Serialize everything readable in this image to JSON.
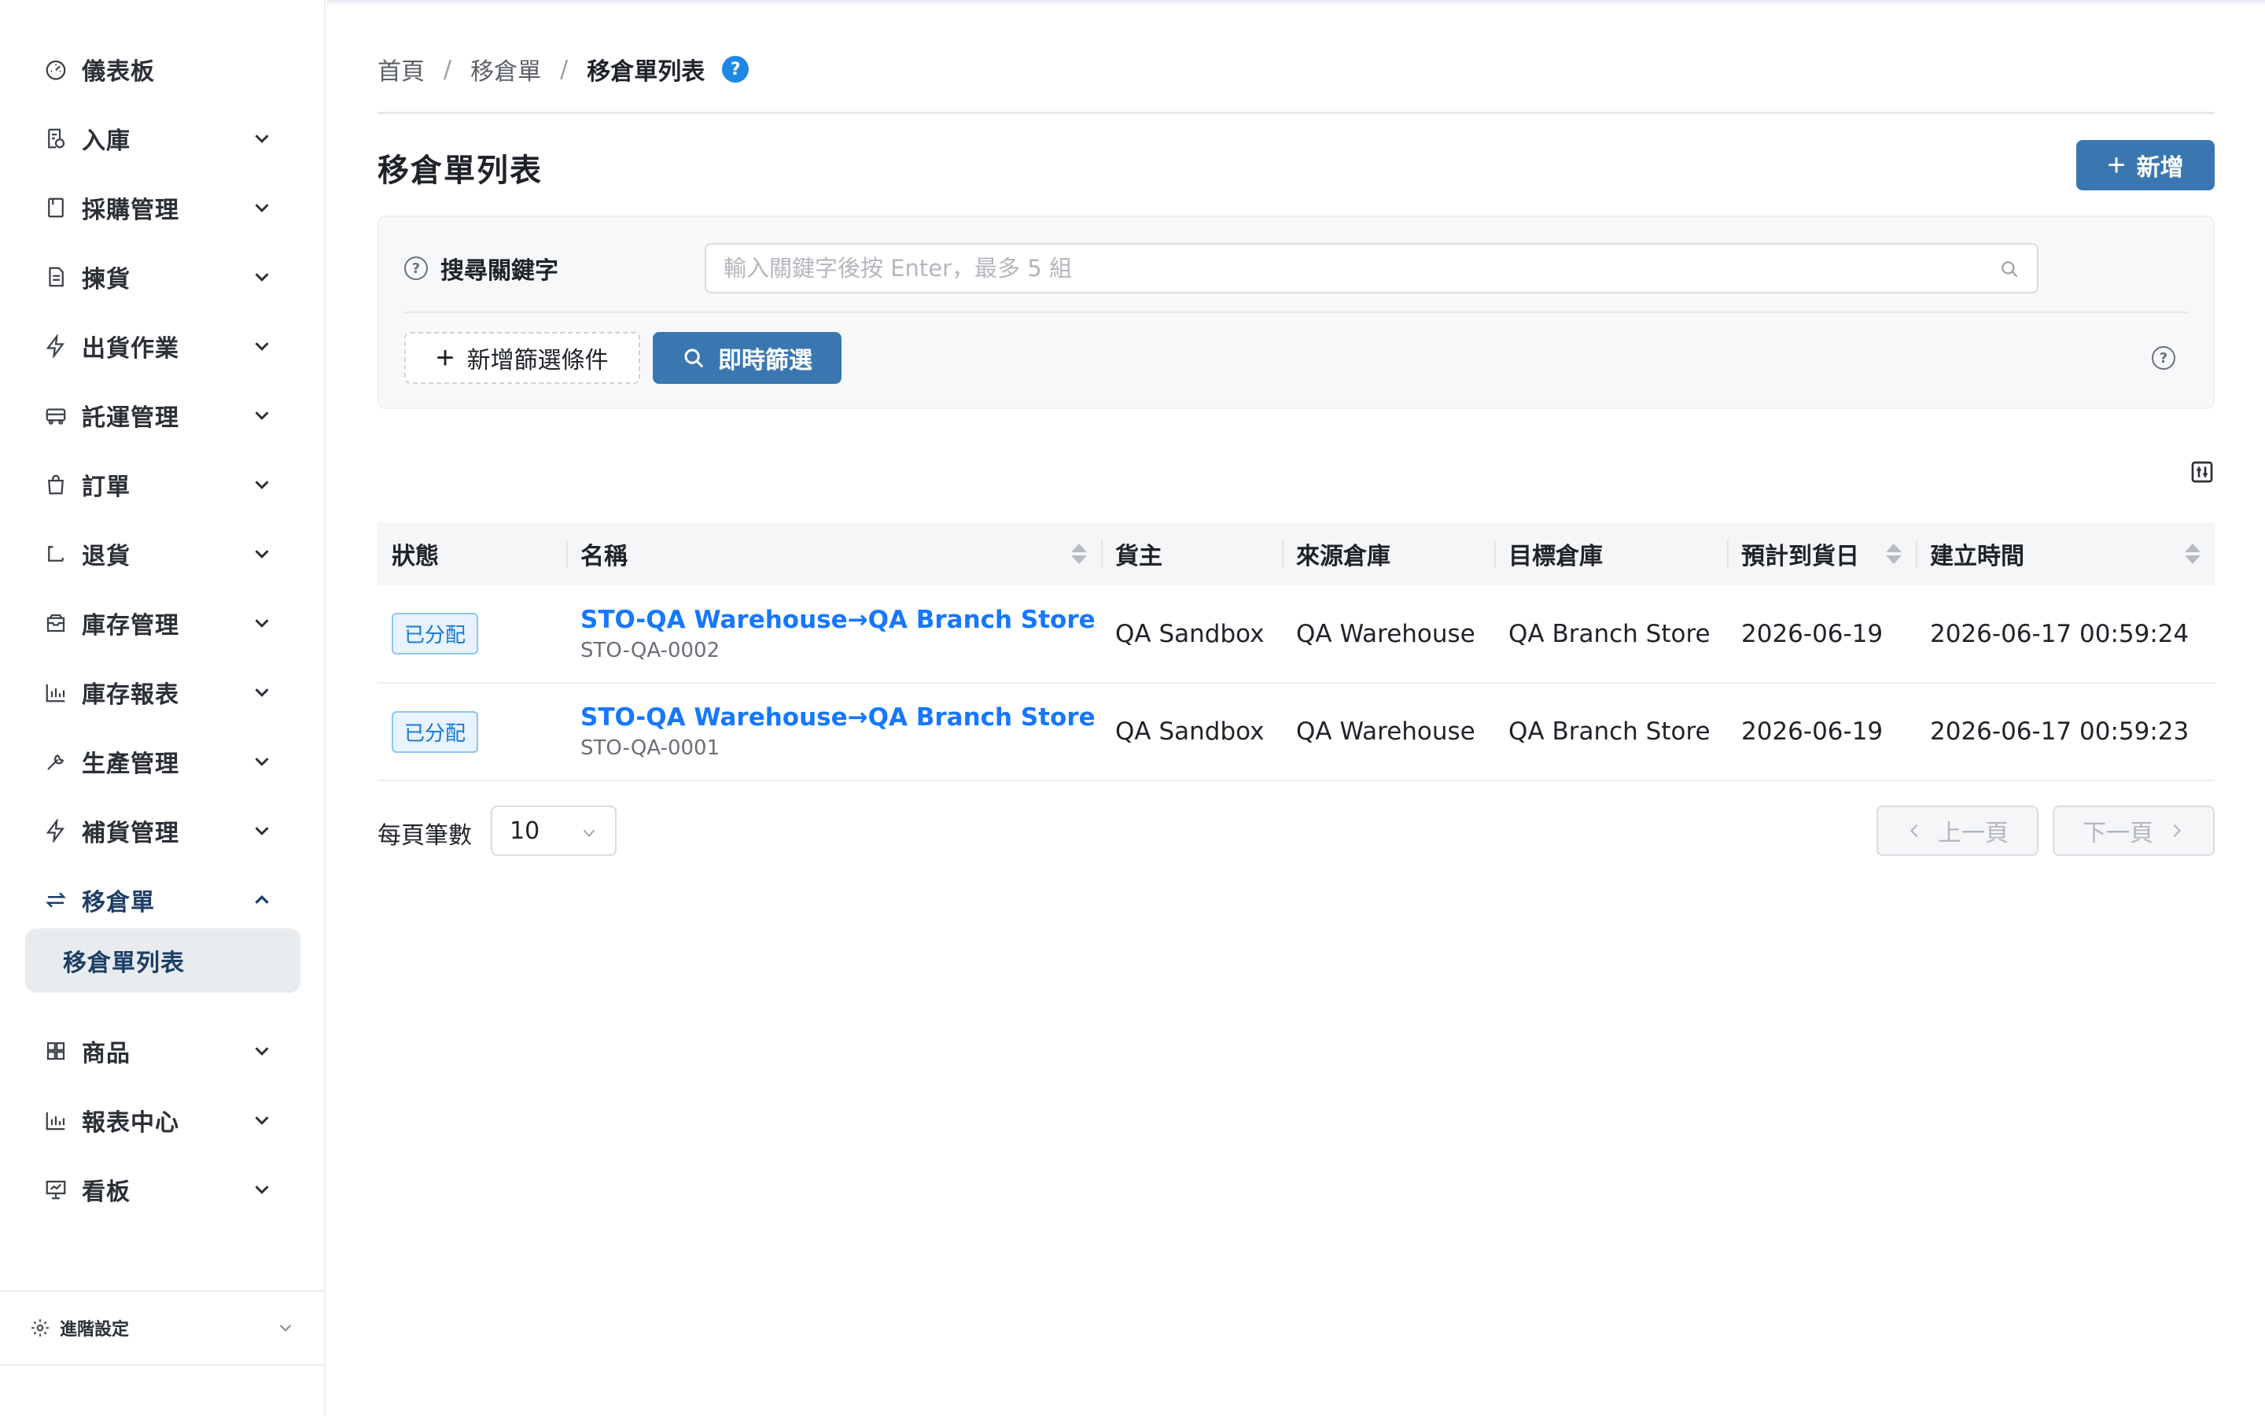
{
  "sidebar": {
    "items": [
      {
        "label": "儀表板",
        "icon": "dashboard-icon"
      },
      {
        "label": "入庫",
        "icon": "inbound-icon"
      },
      {
        "label": "採購管理",
        "icon": "purchase-icon"
      },
      {
        "label": "揀貨",
        "icon": "picking-icon"
      },
      {
        "label": "出貨作業",
        "icon": "lightning-icon"
      },
      {
        "label": "託運管理",
        "icon": "truck-icon"
      },
      {
        "label": "訂單",
        "icon": "shopping-bag-icon"
      },
      {
        "label": "退貨",
        "icon": "return-icon"
      },
      {
        "label": "庫存管理",
        "icon": "inventory-box-icon"
      },
      {
        "label": "庫存報表",
        "icon": "bar-chart-icon"
      },
      {
        "label": "生產管理",
        "icon": "wrench-icon"
      },
      {
        "label": "補貨管理",
        "icon": "lightning-icon"
      },
      {
        "label": "移倉單",
        "icon": "transfer-icon"
      },
      {
        "label": "商品",
        "icon": "grid-icon"
      },
      {
        "label": "報表中心",
        "icon": "bar-chart-icon"
      },
      {
        "label": "看板",
        "icon": "presentation-icon"
      }
    ],
    "active_sub": "移倉單列表",
    "footer_label": "進階設定"
  },
  "breadcrumb": {
    "home": "首頁",
    "section": "移倉單",
    "current": "移倉單列表",
    "help": "?"
  },
  "page": {
    "title": "移倉單列表",
    "add_label": "新增"
  },
  "search": {
    "label": "搜尋關鍵字",
    "placeholder": "輸入關鍵字後按 Enter，最多 5 組",
    "add_filter_label": "新增篩選條件",
    "instant_filter_label": "即時篩選"
  },
  "table": {
    "columns": [
      "狀態",
      "名稱",
      "貨主",
      "來源倉庫",
      "目標倉庫",
      "預計到貨日",
      "建立時間"
    ],
    "rows": [
      {
        "status": "已分配",
        "name": "STO-QA Warehouse→QA Branch Store",
        "code": "STO-QA-0002",
        "owner": "QA Sandbox",
        "source": "QA Warehouse",
        "target": "QA Branch Store",
        "eta": "2026-06-19",
        "created": "2026-06-17 00:59:24"
      },
      {
        "status": "已分配",
        "name": "STO-QA Warehouse→QA Branch Store",
        "code": "STO-QA-0001",
        "owner": "QA Sandbox",
        "source": "QA Warehouse",
        "target": "QA Branch Store",
        "eta": "2026-06-19",
        "created": "2026-06-17 00:59:23"
      }
    ]
  },
  "pagination": {
    "per_page_label": "每頁筆數",
    "per_page_value": "10",
    "prev_label": "上一頁",
    "next_label": "下一頁"
  },
  "colors": {
    "primary": "#3a77b0",
    "link": "#1677ff",
    "active_nav": "#1d3f66",
    "tag_bg": "#e8f3ff",
    "help_badge": "#1e88e5"
  }
}
